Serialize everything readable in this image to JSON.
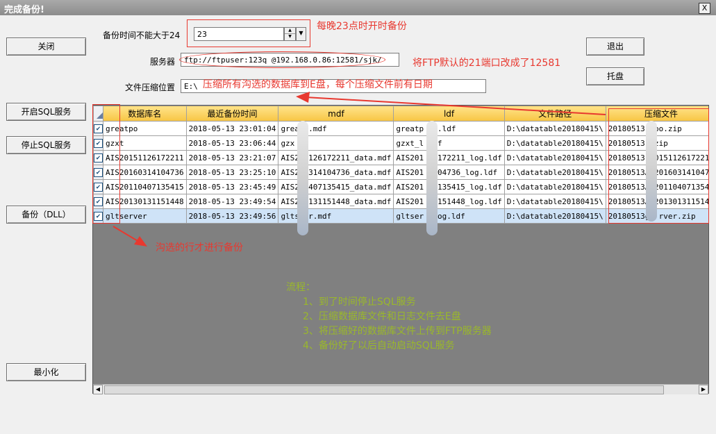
{
  "window": {
    "title": "完成备份!",
    "close_glyph": "X"
  },
  "buttons": {
    "close": "关闭",
    "start_sql": "开启SQL服务",
    "stop_sql": "停止SQL服务",
    "backup_dll": "备份（DLL）",
    "minimize": "最小化",
    "exit": "退出",
    "tray": "托盘"
  },
  "form": {
    "hour_label": "备份时间不能大于24",
    "hour_value": "23",
    "server_label": "服务器",
    "server_value": "ftp://ftpuser:123q    @192.168.0.86:12581/sjk/",
    "compress_label": "文件压缩位置",
    "compress_value": "E:\\"
  },
  "annotations": {
    "hour_note": "每晚23点时开时备份",
    "ftp_note": "将FTP默认的21端口改成了12581",
    "compress_note": "压缩所有沟选的数据库到E盘，每个压缩文件前有日期",
    "check_note": "沟选的行才进行备份"
  },
  "flow": {
    "title": "流程：",
    "steps": [
      "1、到了时间停止SQL服务",
      "2、压缩数据库文件和日志文件去E盘",
      "3、将压缩好的数据库文件上传到FTP服务器",
      "4、备份好了以后自动启动SQL服务"
    ]
  },
  "table": {
    "columns": [
      "数据库名",
      "最近备份时间",
      "mdf",
      "ldf",
      "文件路径",
      "压缩文件"
    ],
    "rows": [
      {
        "checked": true,
        "selected": false,
        "cells": [
          "greatpo",
          "2018-05-13 23:01:04",
          "grea  o.mdf",
          "greatp  og.ldf",
          "D:\\datatable20180415\\",
          "20180513   tpo.zip"
        ]
      },
      {
        "checked": true,
        "selected": false,
        "cells": [
          "gzxt",
          "2018-05-13 23:06:44",
          "gzx  df",
          "gzxt_l  ldf",
          "D:\\datatable20180415\\",
          "20180513    .zip"
        ]
      },
      {
        "checked": true,
        "selected": false,
        "cells": [
          "AIS20151126172211",
          "2018-05-13 23:21:07",
          "AIS2  1126172211_data.mdf",
          "AIS201  26172211_log.ldf",
          "D:\\datatable20180415\\",
          "20180513   2015112617221"
        ]
      },
      {
        "checked": true,
        "selected": false,
        "cells": [
          "AIS20160314104736",
          "2018-05-13 23:25:10",
          "AIS2  0314104736_data.mdf",
          "AIS201  4104736_log.ldf",
          "D:\\datatable20180415\\",
          "20180513A  2016031410473"
        ]
      },
      {
        "checked": true,
        "selected": false,
        "cells": [
          "AIS20110407135415",
          "2018-05-13 23:45:49",
          "AIS2  0407135415_data.mdf",
          "AIS201  07135415_log.ldf",
          "D:\\datatable20180415\\",
          "20180513A  2011040713541"
        ]
      },
      {
        "checked": true,
        "selected": false,
        "cells": [
          "AIS20130131151448",
          "2018-05-13 23:49:54",
          "AIS2  0131151448_data.mdf",
          "AIS201  31151448_log.ldf",
          "D:\\datatable20180415\\",
          "20180513A  2013013115144"
        ]
      },
      {
        "checked": true,
        "selected": true,
        "cells": [
          "gltserver",
          "2018-05-13 23:49:56",
          "glts  er.mdf",
          "gltser  _log.ldf",
          "D:\\datatable20180415\\",
          "20180513gl  rver.zip"
        ]
      }
    ]
  },
  "colors": {
    "annotation": "#e8382f",
    "flow_text": "#9ab82a",
    "header": "#f7c544",
    "grid_bg": "#808080"
  }
}
